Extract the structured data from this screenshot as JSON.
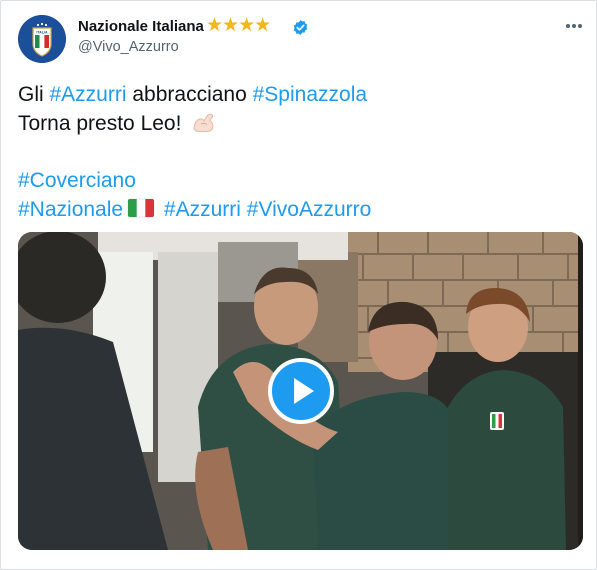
{
  "author": {
    "display_name": "Nazionale Italiana",
    "handle": "@Vivo_Azzurro",
    "stars": "★★★★",
    "avatar_crest_text": "ITALIA"
  },
  "tweet": {
    "line1": {
      "t1": "Gli ",
      "tag1": "#Azzurri",
      "t2": " abbracciano ",
      "tag2": "#Spinazzola"
    },
    "line2": {
      "t1": "Torna presto Leo! "
    },
    "line3": {
      "tag1": "#Coverciano"
    },
    "line4": {
      "tag1": "#Nazionale",
      "tag2": "#Azzurri",
      "tag3": "#VivoAzzurro"
    }
  },
  "icons": {
    "verified": "verified-badge-icon",
    "more": "more-options-icon",
    "play": "play-icon",
    "arm": "flexed-biceps-emoji",
    "flag": "italy-flag-emoji"
  },
  "colors": {
    "link": "#1d9bf0",
    "text": "#0f1419",
    "secondary": "#536471",
    "stars": "#f2b617",
    "play_button": "#1d9bf0"
  }
}
